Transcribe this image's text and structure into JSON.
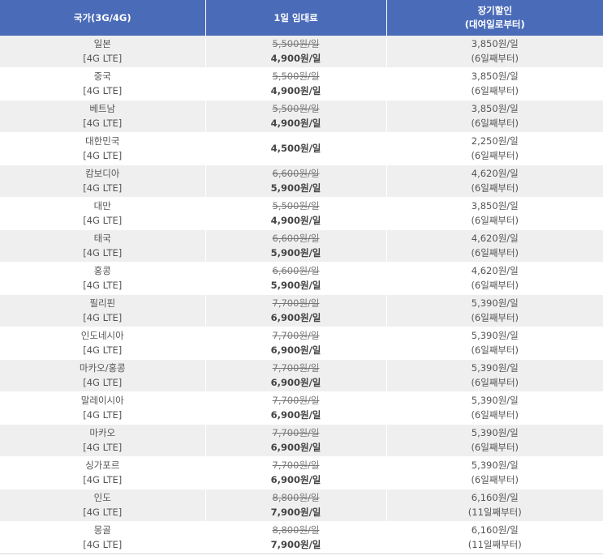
{
  "header": {
    "country": "국가(3G/4G)",
    "daily_rate": "1일 임대료",
    "long_term_line1": "장기할인",
    "long_term_line2": "(대여일로부터)"
  },
  "rows": [
    {
      "country": "일본",
      "network": "[4G LTE]",
      "old_price": "5,500원/일",
      "new_price": "4,900원/일",
      "discount_price": "3,850원/일",
      "discount_note": "(6일째부터)"
    },
    {
      "country": "중국",
      "network": "[4G LTE]",
      "old_price": "5,500원/일",
      "new_price": "4,900원/일",
      "discount_price": "3,850원/일",
      "discount_note": "(6일째부터)"
    },
    {
      "country": "베트남",
      "network": "[4G LTE]",
      "old_price": "5,500원/일",
      "new_price": "4,900원/일",
      "discount_price": "3,850원/일",
      "discount_note": "(6일째부터)"
    },
    {
      "country": "대한민국",
      "network": "[4G LTE]",
      "old_price": "",
      "new_price": "4,500원/일",
      "discount_price": "2,250원/일",
      "discount_note": "(6일째부터)"
    },
    {
      "country": "캄보디아",
      "network": "[4G LTE]",
      "old_price": "6,600원/일",
      "new_price": "5,900원/일",
      "discount_price": "4,620원/일",
      "discount_note": "(6일째부터)"
    },
    {
      "country": "대만",
      "network": "[4G LTE]",
      "old_price": "5,500원/일",
      "new_price": "4,900원/일",
      "discount_price": "3,850원/일",
      "discount_note": "(6일째부터)"
    },
    {
      "country": "태국",
      "network": "[4G LTE]",
      "old_price": "6,600원/일",
      "new_price": "5,900원/일",
      "discount_price": "4,620원/일",
      "discount_note": "(6일째부터)"
    },
    {
      "country": "홍콩",
      "network": "[4G LTE]",
      "old_price": "6,600원/일",
      "new_price": "5,900원/일",
      "discount_price": "4,620원/일",
      "discount_note": "(6일째부터)"
    },
    {
      "country": "필리핀",
      "network": "[4G LTE]",
      "old_price": "7,700원/일",
      "new_price": "6,900원/일",
      "discount_price": "5,390원/일",
      "discount_note": "(6일째부터)"
    },
    {
      "country": "인도네시아",
      "network": "[4G LTE]",
      "old_price": "7,700원/일",
      "new_price": "6,900원/일",
      "discount_price": "5,390원/일",
      "discount_note": "(6일째부터)"
    },
    {
      "country": "마카오/홍콩",
      "network": "[4G LTE]",
      "old_price": "7,700원/일",
      "new_price": "6,900원/일",
      "discount_price": "5,390원/일",
      "discount_note": "(6일째부터)"
    },
    {
      "country": "말레이시아",
      "network": "[4G LTE]",
      "old_price": "7,700원/일",
      "new_price": "6,900원/일",
      "discount_price": "5,390원/일",
      "discount_note": "(6일째부터)"
    },
    {
      "country": "마카오",
      "network": "[4G LTE]",
      "old_price": "7,700원/일",
      "new_price": "6,900원/일",
      "discount_price": "5,390원/일",
      "discount_note": "(6일째부터)"
    },
    {
      "country": "싱가포르",
      "network": "[4G LTE]",
      "old_price": "7,700원/일",
      "new_price": "6,900원/일",
      "discount_price": "5,390원/일",
      "discount_note": "(6일째부터)"
    },
    {
      "country": "인도",
      "network": "[4G LTE]",
      "old_price": "8,800원/일",
      "new_price": "7,900원/일",
      "discount_price": "6,160원/일",
      "discount_note": "(11일째부터)"
    },
    {
      "country": "몽골",
      "network": "[4G LTE]",
      "old_price": "8,800원/일",
      "new_price": "7,900원/일",
      "discount_price": "6,160원/일",
      "discount_note": "(11일째부터)"
    }
  ]
}
